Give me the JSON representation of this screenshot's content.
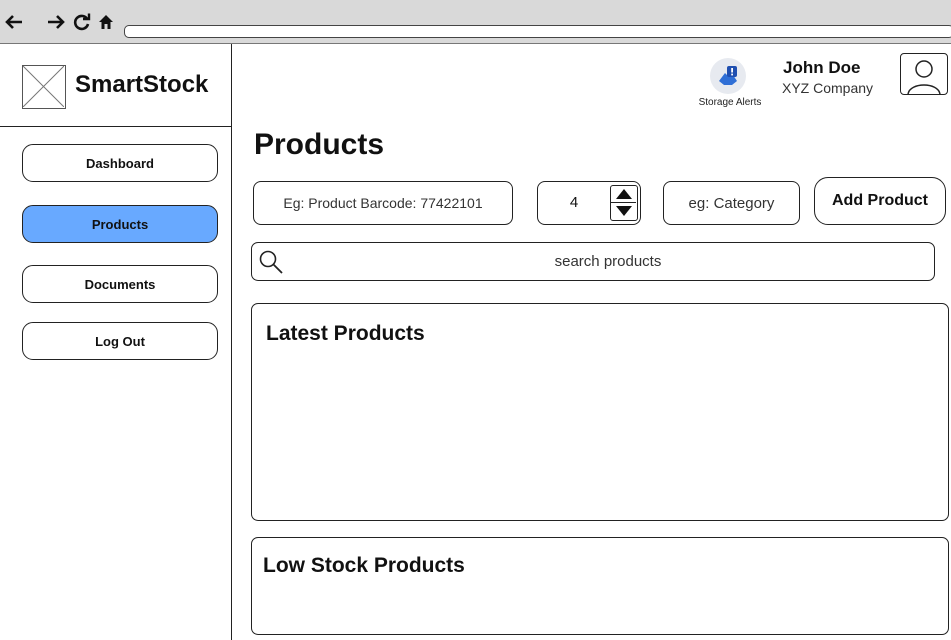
{
  "browser": {
    "back_icon": "arrow-left-icon",
    "forward_icon": "arrow-right-icon",
    "reload_icon": "reload-icon",
    "home_icon": "home-icon"
  },
  "brand": {
    "name": "SmartStock",
    "logo_icon": "image-placeholder-icon"
  },
  "sidebar": {
    "items": [
      {
        "label": "Dashboard",
        "active": false
      },
      {
        "label": "Products",
        "active": true
      },
      {
        "label": "Documents",
        "active": false
      },
      {
        "label": "Log Out",
        "active": false
      }
    ]
  },
  "header": {
    "alerts_label": "Storage Alerts",
    "alerts_icon": "storage-alert-icon",
    "user_name": "John Doe",
    "user_company": "XYZ Company",
    "avatar_icon": "user-avatar-icon"
  },
  "main": {
    "title": "Products",
    "barcode_placeholder": "Eg: Product Barcode: 77422101",
    "quantity_value": "4",
    "category_placeholder": "eg: Category",
    "add_button_label": "Add Product",
    "search_placeholder": "search products",
    "latest_products_title": "Latest Products",
    "low_stock_title": "Low Stock Products"
  },
  "colors": {
    "active_nav": "#68a9ff",
    "chrome": "#d9d9d9",
    "alert_accent": "#2f6fd6"
  }
}
